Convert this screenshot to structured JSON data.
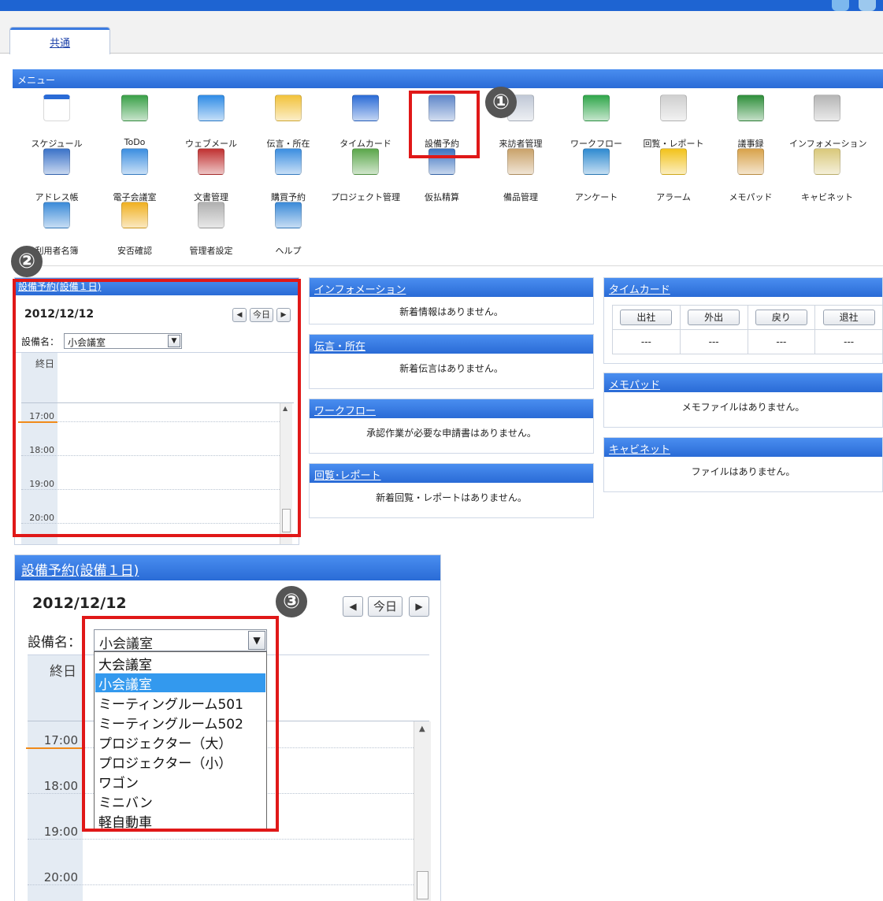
{
  "tabs": [
    {
      "label": "共通"
    }
  ],
  "menu": {
    "title": "メニュー",
    "items": [
      {
        "label": "スケジュール",
        "icon": "calendar-icon",
        "color": "#2a6bd6"
      },
      {
        "label": "ToDo",
        "icon": "todo-icon",
        "color": "#39a047"
      },
      {
        "label": "ウェブメール",
        "icon": "webmail-icon",
        "color": "#2f8ce6"
      },
      {
        "label": "伝言・所在",
        "icon": "memo-note-icon",
        "color": "#f2c23a"
      },
      {
        "label": "タイムカード",
        "icon": "timecard-icon",
        "color": "#2a6bd6"
      },
      {
        "label": "設備予約",
        "icon": "facility-reservation-icon",
        "color": "#5e86c9"
      },
      {
        "label": "来訪者管理",
        "icon": "visitor-icon",
        "color": "#c0c8d6"
      },
      {
        "label": "ワークフロー",
        "icon": "workflow-icon",
        "color": "#2fa64a"
      },
      {
        "label": "回覧・レポート",
        "icon": "report-icon",
        "color": "#cfcfcf"
      },
      {
        "label": "議事録",
        "icon": "minutes-icon",
        "color": "#2e8f3a"
      },
      {
        "label": "インフォメーション",
        "icon": "information-icon",
        "color": "#b5b5b5"
      },
      {
        "label": "アドレス帳",
        "icon": "address-book-icon",
        "color": "#3a72c8"
      },
      {
        "label": "電子会議室",
        "icon": "e-meeting-icon",
        "color": "#3b8ee0"
      },
      {
        "label": "文書管理",
        "icon": "document-management-icon",
        "color": "#c03030"
      },
      {
        "label": "購買予約",
        "icon": "shopping-cart-icon",
        "color": "#3b8ee0"
      },
      {
        "label": "プロジェクト管理",
        "icon": "project-icon",
        "color": "#5aa64a"
      },
      {
        "label": "仮払精算",
        "icon": "expense-icon",
        "color": "#3b72c0"
      },
      {
        "label": "備品管理",
        "icon": "equipment-box-icon",
        "color": "#c9a26a"
      },
      {
        "label": "アンケート",
        "icon": "survey-icon",
        "color": "#2e8ad0"
      },
      {
        "label": "アラーム",
        "icon": "alarm-bell-icon",
        "color": "#f2c21a"
      },
      {
        "label": "メモパッド",
        "icon": "memopad-icon",
        "color": "#d8a24a"
      },
      {
        "label": "キャビネット",
        "icon": "cabinet-icon",
        "color": "#d9c87a"
      },
      {
        "label": "利用者名簿",
        "icon": "user-directory-icon",
        "color": "#3a8ad8"
      },
      {
        "label": "安否確認",
        "icon": "safety-check-icon",
        "color": "#f0b020"
      },
      {
        "label": "管理者設定",
        "icon": "admin-gear-icon",
        "color": "#b0b0b0"
      },
      {
        "label": "ヘルプ",
        "icon": "help-icon",
        "color": "#3a8ad8"
      }
    ]
  },
  "callouts": [
    "①",
    "②",
    "③"
  ],
  "facility_widget": {
    "title": "設備予約(設備１日)",
    "date": "2012/12/12",
    "today_label": "今日",
    "prev_symbol": "◀",
    "next_symbol": "▶",
    "facility_label": "設備名：",
    "selected_facility": "小会議室",
    "allday_label": "終日",
    "times": [
      "17:00",
      "18:00",
      "19:00",
      "20:00"
    ],
    "facility_options": [
      "大会議室",
      "小会議室",
      "ミーティングルーム501",
      "ミーティングルーム502",
      "プロジェクター（大）",
      "プロジェクター（小）",
      "ワゴン",
      "ミニバン",
      "軽自動車"
    ],
    "selected_index": 1
  },
  "info_widget": {
    "title": "インフォメーション",
    "message": "新着情報はありません。"
  },
  "dengon_widget": {
    "title": "伝言・所在",
    "message": "新着伝言はありません。"
  },
  "workflow_widget": {
    "title": "ワークフロー",
    "message": "承認作業が必要な申請書はありません。"
  },
  "report_widget": {
    "title": "回覧･レポート",
    "message": "新着回覧・レポートはありません。"
  },
  "timecard_widget": {
    "title": "タイムカード",
    "buttons": [
      "出社",
      "外出",
      "戻り",
      "退社"
    ],
    "values": [
      "---",
      "---",
      "---",
      "---"
    ]
  },
  "memopad_widget": {
    "title": "メモパッド",
    "message": "メモファイルはありません。"
  },
  "cabinet_widget": {
    "title": "キャビネット",
    "message": "ファイルはありません。"
  }
}
